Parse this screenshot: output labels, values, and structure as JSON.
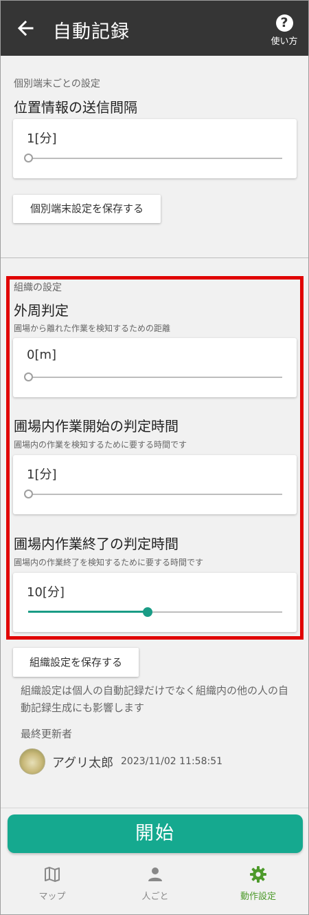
{
  "app_bar": {
    "title": "自動記録",
    "help_label": "使い方",
    "icons": {
      "back": "arrow-left-icon",
      "help": "help-circle-icon"
    }
  },
  "device_settings": {
    "caption": "個別端末ごとの設定",
    "location_interval": {
      "title": "位置情報の送信間隔",
      "value_label": "1[分]",
      "slider_fraction": 0
    },
    "save_button": "個別端末設定を保存する"
  },
  "org_settings": {
    "caption": "組織の設定",
    "perimeter": {
      "title": "外周判定",
      "description": "圃場から離れた作業を検知するための距離",
      "value_label": "0[m]",
      "slider_fraction": 0
    },
    "work_start": {
      "title": "圃場内作業開始の判定時間",
      "description": "圃場内の作業を検知するために要する時間です",
      "value_label": "1[分]",
      "slider_fraction": 0
    },
    "work_end": {
      "title": "圃場内作業終了の判定時間",
      "description": "圃場内の作業終了を検知するために要する時間です",
      "value_label": "10[分]",
      "slider_fraction": 0.47
    },
    "save_button": "組織設定を保存する",
    "note": "組織設定は個人の自動記録だけでなく組織内の他の人の自動記録生成にも影響します",
    "last_updated_label": "最終更新者",
    "last_updated_user": "アグリ太郎",
    "last_updated_at": "2023/11/02 11:58:51"
  },
  "start_button": "開始",
  "bottom_nav": [
    {
      "label": "マップ",
      "icon": "map-icon",
      "active": false
    },
    {
      "label": "人ごと",
      "icon": "person-icon",
      "active": false
    },
    {
      "label": "動作設定",
      "icon": "gear-icon",
      "active": true
    }
  ],
  "colors": {
    "app_bar": "#353535",
    "accent": "#15a98f",
    "highlight_border": "#e00000",
    "nav_active": "#4d9a2b"
  }
}
